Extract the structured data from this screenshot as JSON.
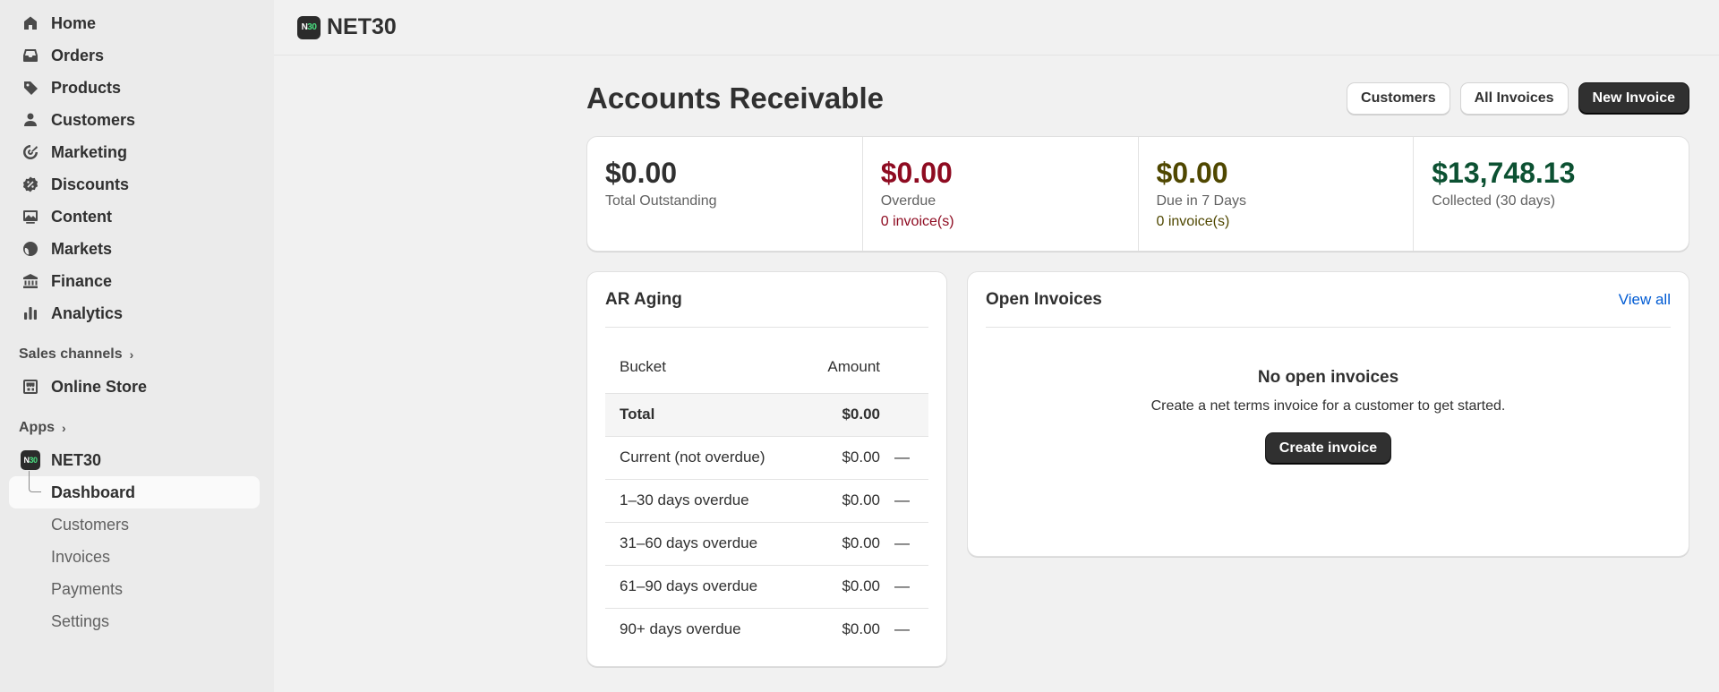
{
  "sidebar": {
    "items": [
      {
        "label": "Home",
        "icon": "home-icon"
      },
      {
        "label": "Orders",
        "icon": "inbox-icon"
      },
      {
        "label": "Products",
        "icon": "tag-icon"
      },
      {
        "label": "Customers",
        "icon": "person-icon"
      },
      {
        "label": "Marketing",
        "icon": "target-icon"
      },
      {
        "label": "Discounts",
        "icon": "discount-icon"
      },
      {
        "label": "Content",
        "icon": "image-icon"
      },
      {
        "label": "Markets",
        "icon": "globe-icon"
      },
      {
        "label": "Finance",
        "icon": "bank-icon"
      },
      {
        "label": "Analytics",
        "icon": "bar-chart-icon"
      }
    ],
    "sales_channels_label": "Sales channels",
    "online_store_label": "Online Store",
    "apps_label": "Apps",
    "app_name": "NET30",
    "app_badge_n": "N",
    "app_badge_num": "30",
    "app_sub_items": [
      "Dashboard",
      "Customers",
      "Invoices",
      "Payments",
      "Settings"
    ]
  },
  "topbar": {
    "title": "NET30"
  },
  "page": {
    "title": "Accounts Receivable",
    "actions": {
      "customers": "Customers",
      "all_invoices": "All Invoices",
      "new_invoice": "New Invoice"
    }
  },
  "stats": [
    {
      "value": "$0.00",
      "label": "Total Outstanding",
      "sub": "",
      "color": "#303030"
    },
    {
      "value": "$0.00",
      "label": "Overdue",
      "sub": "0 invoice(s)",
      "color": "#8e0b21"
    },
    {
      "value": "$0.00",
      "label": "Due in 7 Days",
      "sub": "0 invoice(s)",
      "color": "#4f4700"
    },
    {
      "value": "$13,748.13",
      "label": "Collected (30 days)",
      "sub": "",
      "color": "#0c5132"
    }
  ],
  "ar_aging": {
    "title": "AR Aging",
    "headers": {
      "bucket": "Bucket",
      "amount": "Amount"
    },
    "total": {
      "label": "Total",
      "amount": "$0.00"
    },
    "rows": [
      {
        "label": "Current (not overdue)",
        "amount": "$0.00",
        "trend": "—"
      },
      {
        "label": "1–30 days overdue",
        "amount": "$0.00",
        "trend": "—"
      },
      {
        "label": "31–60 days overdue",
        "amount": "$0.00",
        "trend": "—"
      },
      {
        "label": "61–90 days overdue",
        "amount": "$0.00",
        "trend": "—"
      },
      {
        "label": "90+ days overdue",
        "amount": "$0.00",
        "trend": "—"
      }
    ]
  },
  "open_invoices": {
    "title": "Open Invoices",
    "view_all": "View all",
    "empty_title": "No open invoices",
    "empty_text": "Create a net terms invoice for a customer to get started.",
    "create_button": "Create invoice"
  }
}
